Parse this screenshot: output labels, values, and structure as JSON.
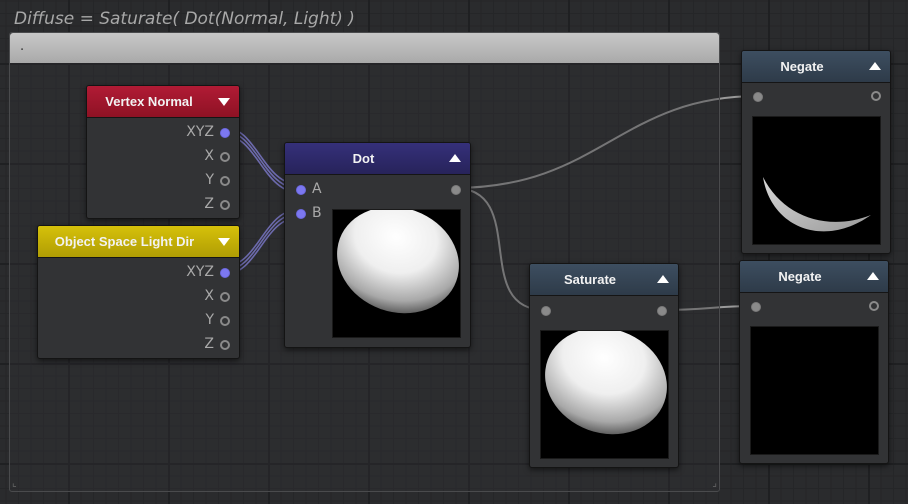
{
  "graph": {
    "title": "Diffuse = Saturate( Dot(Normal, Light) )",
    "comment_text": "."
  },
  "nodes": {
    "vertex_normal": {
      "title": "Vertex Normal",
      "header_color": "#a8182f",
      "outputs": [
        "XYZ",
        "X",
        "Y",
        "Z"
      ]
    },
    "object_space_light_dir": {
      "title": "Object Space Light Dir",
      "header_color": "#c9b406",
      "outputs": [
        "XYZ",
        "X",
        "Y",
        "Z"
      ]
    },
    "dot": {
      "title": "Dot",
      "header_color": "#2f2a66",
      "inputs": [
        "A",
        "B"
      ]
    },
    "saturate": {
      "title": "Saturate",
      "header_color": "#364555"
    },
    "negate_top": {
      "title": "Negate",
      "header_color": "#364555"
    },
    "negate_bottom": {
      "title": "Negate",
      "header_color": "#364555"
    }
  },
  "colors": {
    "port_connected": "#7c78f0",
    "wire_vector": "#9d99ff",
    "wire_scalar": "#9a9a9a"
  }
}
